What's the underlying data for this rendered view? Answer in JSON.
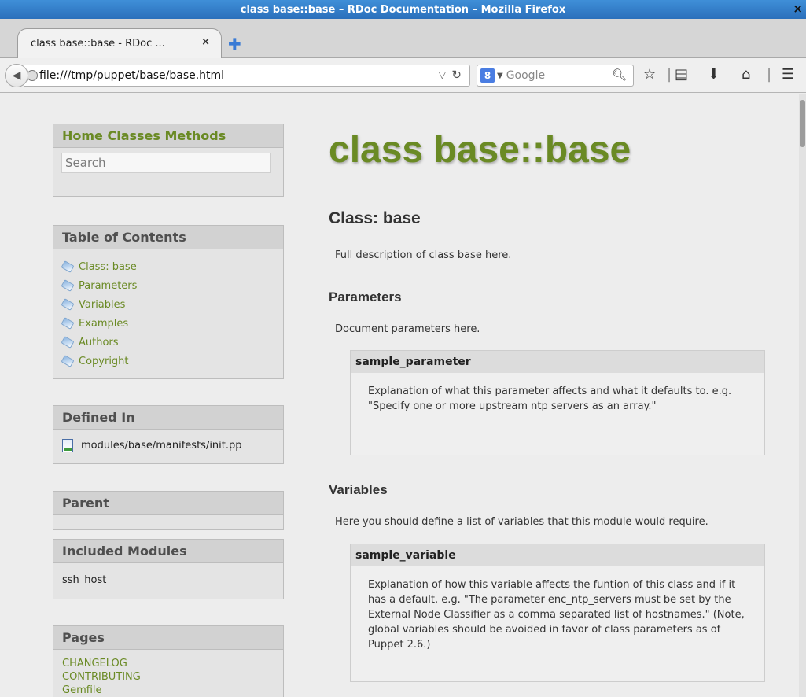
{
  "window": {
    "title": "class base::base – RDoc Documentation – Mozilla Firefox",
    "close_glyph": "×"
  },
  "tab": {
    "label": "class base::base - RDoc ...",
    "close_glyph": "×",
    "new_tab_glyph": "✚"
  },
  "navbar": {
    "url": "file:///tmp/puppet/base/base.html",
    "search_placeholder": "Google",
    "search_engine_glyph": "8",
    "icons": [
      "back-icon",
      "globe-icon",
      "reload-icon",
      "search-icon",
      "bookmark-star-icon",
      "reading-list-icon",
      "download-icon",
      "home-icon",
      "menu-icon"
    ]
  },
  "sidebar": {
    "nav_title": "Home Classes Methods",
    "search_placeholder": "Search",
    "toc_title": "Table of Contents",
    "toc_items": [
      "Class: base",
      "Parameters",
      "Variables",
      "Examples",
      "Authors",
      "Copyright"
    ],
    "defined_in_title": "Defined In",
    "defined_in_file": "modules/base/manifests/init.pp",
    "parent_title": "Parent",
    "included_modules_title": "Included Modules",
    "included_module": "ssh_host",
    "pages_title": "Pages",
    "pages": [
      "CHANGELOG",
      "CONTRIBUTING",
      "Gemfile"
    ]
  },
  "main": {
    "title": "class base::base",
    "class_heading": "Class: base",
    "class_description": "Full description of class base here.",
    "parameters_heading": "Parameters",
    "parameters_intro": "Document parameters here.",
    "parameter_name": "sample_parameter",
    "parameter_description": "Explanation of what this parameter affects and what it defaults to. e.g. \"Specify one or more upstream ntp servers as an array.\"",
    "variables_heading": "Variables",
    "variables_intro": "Here you should define a list of variables that this module would require.",
    "variable_name": "sample_variable",
    "variable_description": "Explanation of how this variable affects the funtion of this class and if it has a default. e.g. \"The parameter enc_ntp_servers must be set by the External Node Classifier as a comma separated list of hostnames.\" (Note, global variables should be avoided in favor of class parameters as of Puppet 2.6.)"
  }
}
